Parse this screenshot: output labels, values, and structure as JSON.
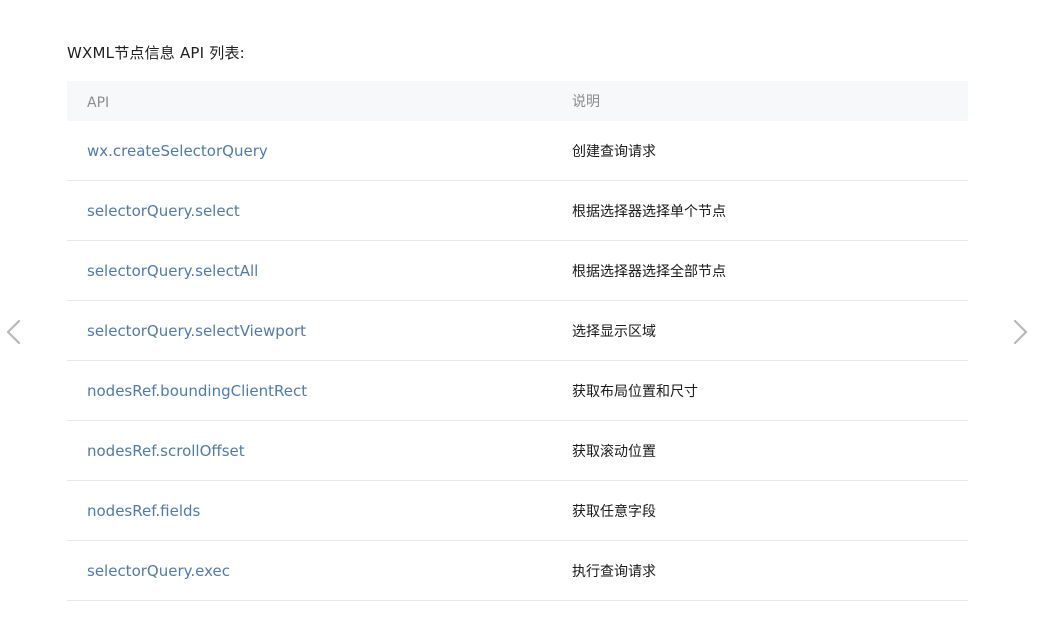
{
  "title": "WXML节点信息 API 列表:",
  "table": {
    "headers": {
      "api": "API",
      "description": "说明"
    },
    "rows": [
      {
        "api": "wx.createSelectorQuery",
        "description": "创建查询请求"
      },
      {
        "api": "selectorQuery.select",
        "description": "根据选择器选择单个节点"
      },
      {
        "api": "selectorQuery.selectAll",
        "description": "根据选择器选择全部节点"
      },
      {
        "api": "selectorQuery.selectViewport",
        "description": "选择显示区域"
      },
      {
        "api": "nodesRef.boundingClientRect",
        "description": "获取布局位置和尺寸"
      },
      {
        "api": "nodesRef.scrollOffset",
        "description": "获取滚动位置"
      },
      {
        "api": "nodesRef.fields",
        "description": "获取任意字段"
      },
      {
        "api": "selectorQuery.exec",
        "description": "执行查询请求"
      }
    ]
  },
  "navigation": {
    "prev_icon": "chevron-left-icon",
    "next_icon": "chevron-right-icon"
  },
  "colors": {
    "link": "#4f7bae",
    "header_bg": "#f7f8fa",
    "header_text": "#8c8c8c",
    "divider": "#e6e6e6",
    "arrow": "#b8b8b8"
  }
}
